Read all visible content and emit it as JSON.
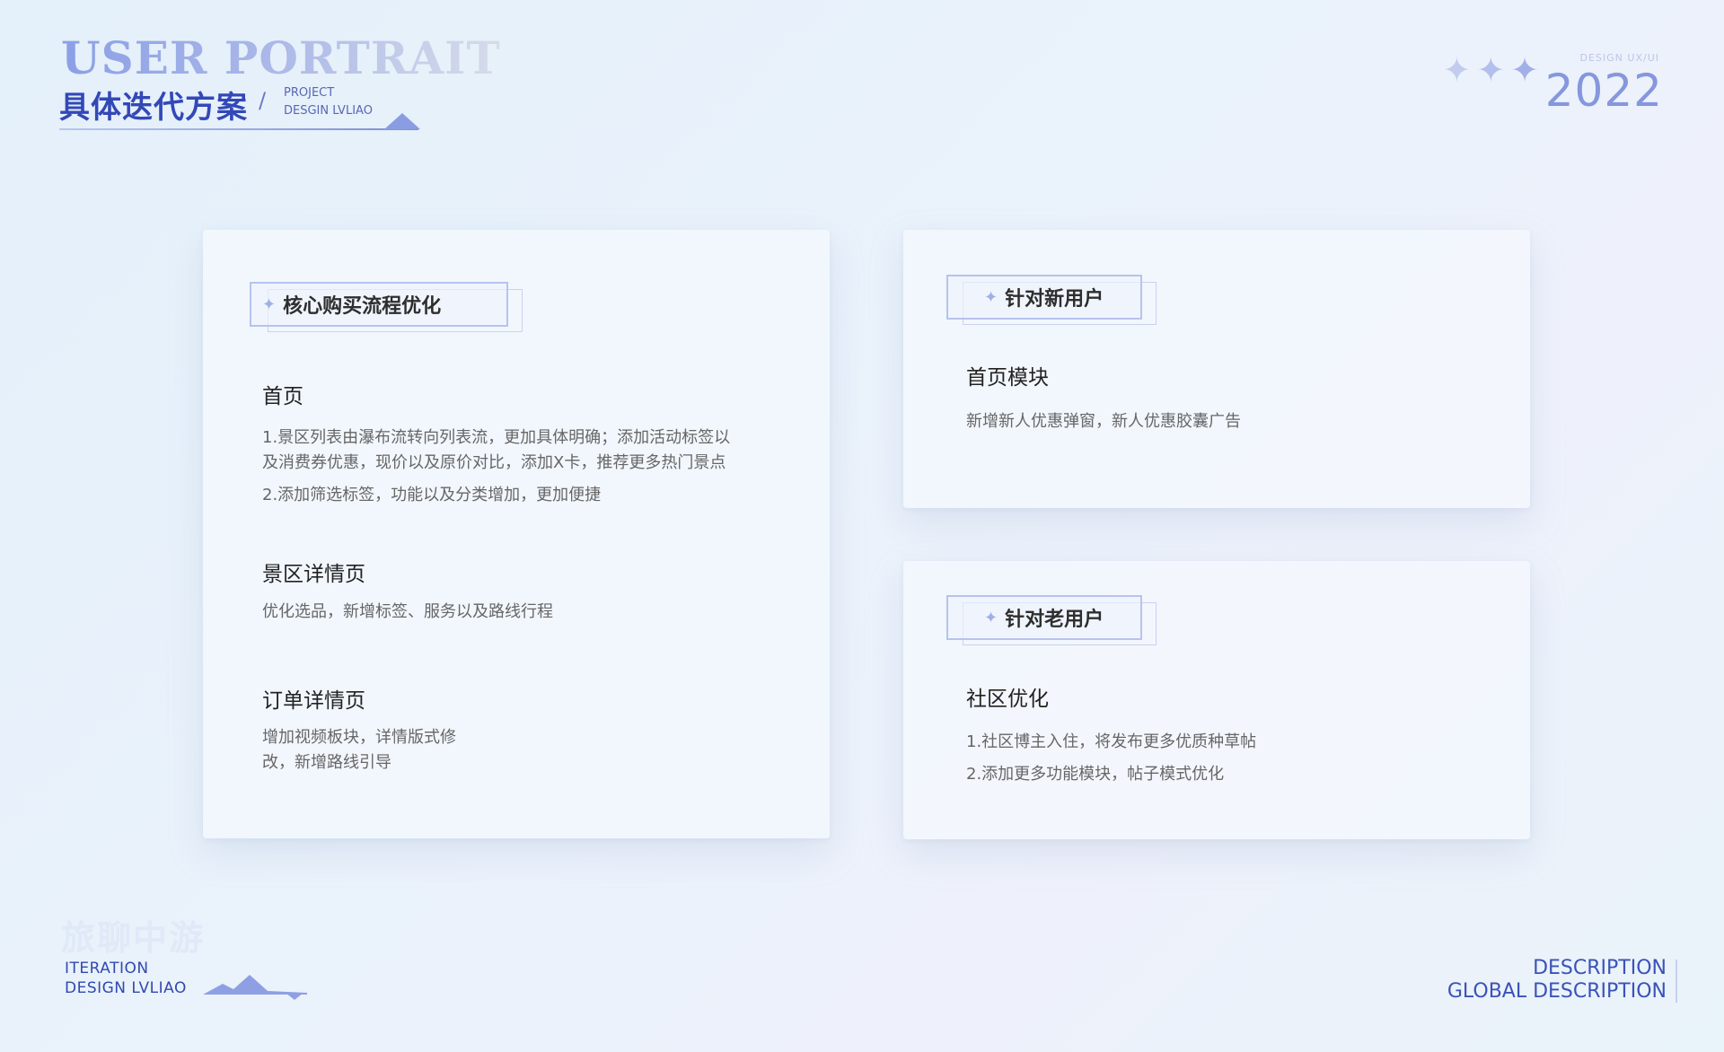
{
  "header": {
    "title_en": "USER PORTRAIT",
    "title_cn": "具体迭代方案",
    "slash": "/",
    "project_line1": "PROJECT",
    "project_line2": "DESGIN LVLIAO",
    "design_label": "DESIGN   UX/UI",
    "year": "2022"
  },
  "card_core": {
    "tag": "核心购买流程优化",
    "sections": [
      {
        "title": "首页",
        "lines": [
          "1.景区列表由瀑布流转向列表流，更加具体明确；添加活动标签以",
          "及消费券优惠，现价以及原价对比，添加X卡，推荐更多热门景点",
          "2.添加筛选标签，功能以及分类增加，更加便捷"
        ]
      },
      {
        "title": "景区详情页",
        "lines": [
          "优化选品，新增标签、服务以及路线行程"
        ]
      },
      {
        "title": "订单详情页",
        "lines": [
          "增加视频板块，详情版式修",
          "改，新增路线引导"
        ]
      }
    ]
  },
  "card_new": {
    "tag": "针对新用户",
    "title": "首页模块",
    "lines": [
      "新增新人优惠弹窗，新人优惠胶囊广告"
    ]
  },
  "card_old": {
    "tag": "针对老用户",
    "title": "社区优化",
    "lines": [
      "1.社区博主入住，将发布更多优质种草帖",
      "2.添加更多功能模块，帖子模式优化"
    ]
  },
  "footer": {
    "brand_cn": "旅聊中游",
    "line1": "ITERATION",
    "line2": "DESIGN   LVLIAO",
    "desc_line1": "DESCRIPTION",
    "desc_line2": "GLOBAL DESCRIPTION"
  },
  "icons": {
    "tag_icon": "four-point-star-icon",
    "header_decor": "four-point-star-icon"
  },
  "colors": {
    "accent": "#3348b7",
    "accent_light": "#8597dd"
  }
}
